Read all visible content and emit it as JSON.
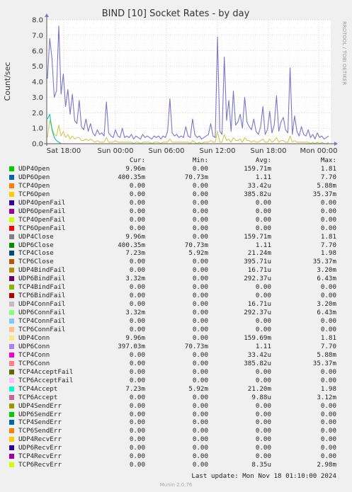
{
  "chart_data": {
    "type": "line",
    "title": "BIND [10] Socket Rates - by day",
    "ylabel": "Count/sec",
    "ylim": [
      0,
      8
    ],
    "yticks": [
      "0.0",
      "1.0",
      "2.0",
      "3.0",
      "4.0",
      "5.0",
      "6.0",
      "7.0",
      "8.0"
    ],
    "xticks": [
      "Sat 18:00",
      "Sun 00:00",
      "Sun 06:00",
      "Sun 12:00",
      "Sun 18:00",
      "Mon 00:00"
    ],
    "grid": true,
    "side_label": "RRDTOOL / TOBI OETIKER",
    "series": [
      {
        "name": "UDP6Close",
        "color": "#7777cc",
        "values": [
          4.2,
          6.8,
          5.5,
          3.0,
          3.4,
          7.6,
          3.2,
          4.5,
          2.4,
          3.5,
          1.9,
          3.2,
          1.5,
          1.3,
          2.8,
          1.1,
          0.9,
          1.6,
          0.8,
          1.3,
          0.7,
          0.5,
          0.9,
          0.6,
          0.7,
          0.5,
          2.7,
          0.7,
          0.5,
          0.4,
          0.9,
          0.5,
          0.4,
          1.0,
          0.4,
          0.5,
          0.4,
          0.6,
          0.3,
          0.5,
          0.4,
          0.3,
          0.6,
          0.4,
          0.5,
          0.4,
          0.3,
          0.5,
          0.4,
          0.5,
          0.3,
          0.5,
          0.4,
          0.8,
          2.9,
          0.7,
          0.5,
          0.6,
          0.4,
          0.5,
          0.4,
          1.1,
          0.5,
          0.4,
          1.6,
          0.6,
          0.4,
          0.5,
          0.3,
          0.4,
          0.5,
          0.6,
          1.3,
          0.5,
          0.4,
          6.9,
          0.8,
          0.6,
          5.6,
          1.5,
          2.8,
          0.8,
          3.4,
          1.2,
          1.4,
          1.9,
          1.0,
          3.0,
          1.4,
          1.1,
          0.9,
          1.6,
          0.8,
          0.6,
          1.1,
          2.4,
          0.6,
          0.9,
          2.1,
          0.7,
          1.2,
          3.1,
          0.8,
          1.4,
          1.7,
          0.9,
          0.7,
          4.9,
          0.6,
          1.8,
          0.8,
          0.5,
          1.1,
          0.6,
          0.5,
          0.9,
          0.4,
          0.6,
          0.3,
          0.7,
          0.4,
          0.5,
          0.3,
          0.4,
          0.5
        ]
      },
      {
        "name": "UDP4Close",
        "color": "#cccc55",
        "values": [
          0.4,
          1.5,
          1.0,
          0.6,
          0.5,
          1.2,
          0.5,
          0.8,
          0.4,
          0.6,
          0.3,
          0.5,
          0.3,
          0.4,
          0.4,
          0.2,
          0.2,
          0.3,
          0.2,
          0.3,
          0.2,
          0.1,
          0.2,
          0.1,
          0.1,
          0.1,
          0.4,
          0.1,
          0.1,
          0.1,
          0.2,
          0.1,
          0.1,
          0.1,
          0.1,
          0.1,
          0.1,
          0.1,
          0.0,
          0.1,
          0.1,
          0.0,
          0.1,
          0.1,
          0.1,
          0.1,
          0.0,
          0.1,
          0.1,
          0.1,
          0.0,
          0.1,
          0.1,
          0.1,
          0.3,
          0.1,
          0.1,
          0.1,
          0.1,
          0.1,
          0.1,
          0.1,
          0.1,
          0.0,
          0.2,
          0.1,
          0.0,
          0.1,
          0.0,
          0.1,
          0.1,
          0.1,
          0.2,
          0.1,
          0.1,
          0.8,
          0.1,
          0.1,
          0.6,
          0.2,
          0.3,
          0.1,
          0.4,
          0.2,
          0.2,
          0.3,
          0.1,
          0.4,
          0.2,
          0.2,
          0.1,
          0.2,
          0.1,
          0.1,
          0.2,
          0.3,
          0.1,
          0.1,
          0.3,
          0.1,
          0.2,
          0.4,
          0.1,
          0.2,
          0.2,
          0.1,
          0.1,
          0.5,
          0.1,
          0.2,
          0.1,
          0.1,
          0.1,
          0.1,
          0.1,
          0.1,
          0.0,
          0.1,
          0.0,
          0.1,
          0.0,
          0.1,
          0.0,
          0.0,
          0.1
        ]
      },
      {
        "name": "TCP4Accept",
        "color": "#00cc99",
        "values": [
          1.6,
          1.9,
          0.9,
          0.4,
          0.2,
          0.1,
          0,
          0,
          0,
          0,
          0,
          0,
          0,
          0,
          0,
          0,
          0,
          0,
          0,
          0,
          0,
          0,
          0,
          0,
          0,
          0,
          0,
          0,
          0,
          0,
          0,
          0,
          0,
          0,
          0,
          0,
          0,
          0,
          0,
          0,
          0,
          0,
          0,
          0,
          0,
          0,
          0,
          0,
          0,
          0,
          0,
          0,
          0,
          0,
          0,
          0,
          0,
          0,
          0,
          0,
          0,
          0,
          0,
          0,
          0,
          0,
          0,
          0,
          0,
          0,
          0,
          0,
          0,
          0,
          0,
          0,
          0,
          0,
          0,
          0,
          0,
          0,
          0,
          0,
          0,
          0,
          0,
          0,
          0,
          0,
          0,
          0,
          0,
          0,
          0,
          0,
          0,
          0,
          0,
          0,
          0,
          0,
          0,
          0,
          0,
          0,
          0,
          0,
          0,
          0,
          0,
          0,
          0,
          0,
          0,
          0,
          0,
          0,
          0,
          0,
          0,
          0,
          0,
          0,
          0
        ]
      }
    ]
  },
  "legend": {
    "headers": {
      "cur": "Cur:",
      "min": "Min:",
      "avg": "Avg:",
      "max": "Max:"
    },
    "rows": [
      {
        "name": "UDP4Open",
        "color": "#00cc00",
        "cur": "9.96m",
        "min": "0.00",
        "avg": "159.71m",
        "max": "1.81"
      },
      {
        "name": "UDP6Open",
        "color": "#0066b3",
        "cur": "400.35m",
        "min": "70.73m",
        "avg": "1.11",
        "max": "7.70"
      },
      {
        "name": "TCP4Open",
        "color": "#ff8000",
        "cur": "0.00",
        "min": "0.00",
        "avg": "33.42u",
        "max": "5.88m"
      },
      {
        "name": "TCP6Open",
        "color": "#ffcc00",
        "cur": "0.00",
        "min": "0.00",
        "avg": "385.82u",
        "max": "35.37m"
      },
      {
        "name": "UDP4OpenFail",
        "color": "#330099",
        "cur": "0.00",
        "min": "0.00",
        "avg": "0.00",
        "max": "0.00"
      },
      {
        "name": "UDP6OpenFail",
        "color": "#990099",
        "cur": "0.00",
        "min": "0.00",
        "avg": "0.00",
        "max": "0.00"
      },
      {
        "name": "TCP4OpenFail",
        "color": "#ccff00",
        "cur": "0.00",
        "min": "0.00",
        "avg": "0.00",
        "max": "0.00"
      },
      {
        "name": "TCP6OpenFail",
        "color": "#ff0000",
        "cur": "0.00",
        "min": "0.00",
        "avg": "0.00",
        "max": "0.00"
      },
      {
        "name": "UDP4Close",
        "color": "#808080",
        "cur": "9.96m",
        "min": "0.00",
        "avg": "159.71m",
        "max": "1.81"
      },
      {
        "name": "UDP6Close",
        "color": "#008f00",
        "cur": "400.35m",
        "min": "70.73m",
        "avg": "1.11",
        "max": "7.70"
      },
      {
        "name": "TCP4Close",
        "color": "#00487d",
        "cur": "7.23m",
        "min": "5.92m",
        "avg": "21.24m",
        "max": "1.98"
      },
      {
        "name": "TCP6Close",
        "color": "#b35a00",
        "cur": "0.00",
        "min": "0.00",
        "avg": "395.71u",
        "max": "35.37m"
      },
      {
        "name": "UDP4BindFail",
        "color": "#b38f00",
        "cur": "0.00",
        "min": "0.00",
        "avg": "16.71u",
        "max": "3.20m"
      },
      {
        "name": "UDP6BindFail",
        "color": "#6b006b",
        "cur": "3.32m",
        "min": "0.00",
        "avg": "292.37u",
        "max": "6.43m"
      },
      {
        "name": "TCP4BindFail",
        "color": "#8fb300",
        "cur": "0.00",
        "min": "0.00",
        "avg": "0.00",
        "max": "0.00"
      },
      {
        "name": "TCP6BindFail",
        "color": "#b30000",
        "cur": "0.00",
        "min": "0.00",
        "avg": "0.00",
        "max": "0.00"
      },
      {
        "name": "UDP4ConnFail",
        "color": "#bebebe",
        "cur": "0.00",
        "min": "0.00",
        "avg": "16.71u",
        "max": "3.20m"
      },
      {
        "name": "UDP6ConnFail",
        "color": "#80ff80",
        "cur": "3.32m",
        "min": "0.00",
        "avg": "292.37u",
        "max": "6.43m"
      },
      {
        "name": "TCP4ConnFail",
        "color": "#80c9ff",
        "cur": "0.00",
        "min": "0.00",
        "avg": "0.00",
        "max": "0.00"
      },
      {
        "name": "TCP6ConnFail",
        "color": "#ffc080",
        "cur": "0.00",
        "min": "0.00",
        "avg": "0.00",
        "max": "0.00"
      },
      {
        "name": "UDP4Conn",
        "color": "#ffe680",
        "cur": "9.96m",
        "min": "0.00",
        "avg": "159.69m",
        "max": "1.81"
      },
      {
        "name": "UDP6Conn",
        "color": "#aa80ff",
        "cur": "397.03m",
        "min": "70.73m",
        "avg": "1.11",
        "max": "7.70"
      },
      {
        "name": "TCP4Conn",
        "color": "#ee00cc",
        "cur": "0.00",
        "min": "0.00",
        "avg": "33.42u",
        "max": "5.88m"
      },
      {
        "name": "TCP6Conn",
        "color": "#ff8080",
        "cur": "0.00",
        "min": "0.00",
        "avg": "385.82u",
        "max": "35.37m"
      },
      {
        "name": "TCP4AcceptFail",
        "color": "#666600",
        "cur": "0.00",
        "min": "0.00",
        "avg": "0.00",
        "max": "0.00"
      },
      {
        "name": "TCP6AcceptFail",
        "color": "#ffbfff",
        "cur": "0.00",
        "min": "0.00",
        "avg": "0.00",
        "max": "0.00"
      },
      {
        "name": "TCP4Accept",
        "color": "#00ffcc",
        "cur": "7.23m",
        "min": "5.92m",
        "avg": "21.20m",
        "max": "1.98"
      },
      {
        "name": "TCP6Accept",
        "color": "#cc6699",
        "cur": "0.00",
        "min": "0.00",
        "avg": "9.88u",
        "max": "3.12m"
      },
      {
        "name": "UDP4SendErr",
        "color": "#999900",
        "cur": "0.00",
        "min": "0.00",
        "avg": "0.00",
        "max": "0.00"
      },
      {
        "name": "UDP6SendErr",
        "color": "#00cc00",
        "cur": "0.00",
        "min": "0.00",
        "avg": "0.00",
        "max": "0.00"
      },
      {
        "name": "TCP4SendErr",
        "color": "#0066b3",
        "cur": "0.00",
        "min": "0.00",
        "avg": "0.00",
        "max": "0.00"
      },
      {
        "name": "TCP6SendErr",
        "color": "#ff8000",
        "cur": "0.00",
        "min": "0.00",
        "avg": "0.00",
        "max": "0.00"
      },
      {
        "name": "UDP4RecvErr",
        "color": "#ffcc00",
        "cur": "0.00",
        "min": "0.00",
        "avg": "0.00",
        "max": "0.00"
      },
      {
        "name": "UDP6RecvErr",
        "color": "#330099",
        "cur": "0.00",
        "min": "0.00",
        "avg": "0.00",
        "max": "0.00"
      },
      {
        "name": "TCP4RecvErr",
        "color": "#990099",
        "cur": "0.00",
        "min": "0.00",
        "avg": "0.00",
        "max": "0.00"
      },
      {
        "name": "TCP6RecvErr",
        "color": "#ccff00",
        "cur": "0.00",
        "min": "0.00",
        "avg": "8.35u",
        "max": "2.98m"
      }
    ]
  },
  "footer": {
    "last_update": "Last update: Mon Nov 18 01:10:00 2024",
    "munin": "Munin 2.0.76"
  }
}
